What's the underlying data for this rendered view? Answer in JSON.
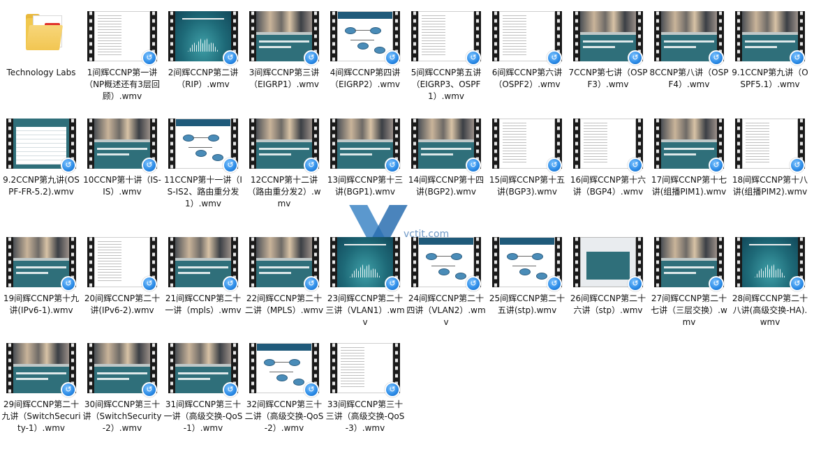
{
  "folder": {
    "label": "Technology Labs",
    "icon": "folder-icon"
  },
  "watermark": "vctit.com",
  "files": [
    {
      "label": "1间辉CCNP第一讲（NP概述还有3层回顾）.wmv",
      "thumb": "text"
    },
    {
      "label": "2间辉CCNP第二讲（RIP）.wmv",
      "thumb": "cisco"
    },
    {
      "label": "3间辉CCNP第三讲（EIGRP1）.wmv",
      "thumb": "slide"
    },
    {
      "label": "4间辉CCNP第四讲（EIGRP2）.wmv",
      "thumb": "diagram"
    },
    {
      "label": "5间辉CCNP第五讲（EIGRP3、OSPF1）.wmv",
      "thumb": "text"
    },
    {
      "label": "6间辉CCNP第六讲（OSPF2）.wmv",
      "thumb": "text"
    },
    {
      "label": "7CCNP第七讲（OSPF3）.wmv",
      "thumb": "slide"
    },
    {
      "label": "8CCNP第八讲（OSPF4）.wmv",
      "thumb": "slide"
    },
    {
      "label": "9.1CCNP第九讲（OSPF5.1）.wmv",
      "thumb": "slide"
    },
    {
      "label": "9.2CCNP第九讲(OSPF-FR-5.2).wmv",
      "thumb": "table"
    },
    {
      "label": "10CCNP第十讲（IS-IS）.wmv",
      "thumb": "slide"
    },
    {
      "label": "11CCNP第十一讲（IS-IS2、路由重分发1）.wmv",
      "thumb": "diagram"
    },
    {
      "label": "12CCNP第十二讲（路由重分发2）.wmv",
      "thumb": "slide"
    },
    {
      "label": "13间辉CCNP第十三讲(BGP1).wmv",
      "thumb": "slide"
    },
    {
      "label": "14间辉CCNP第十四讲(BGP2).wmv",
      "thumb": "slide"
    },
    {
      "label": "15间辉CCNP第十五讲(BGP3).wmv",
      "thumb": "text"
    },
    {
      "label": "16间辉CCNP第十六讲（BGP4）.wmv",
      "thumb": "text"
    },
    {
      "label": "17间辉CCNP第十七讲(组播PIM1).wmv",
      "thumb": "slide"
    },
    {
      "label": "18间辉CCNP第十八讲(组播PIM2).wmv",
      "thumb": "text"
    },
    {
      "label": "19间辉CCNP第十九讲(IPv6-1).wmv",
      "thumb": "slide"
    },
    {
      "label": "20间辉CCNP第二十讲(IPv6-2).wmv",
      "thumb": "text"
    },
    {
      "label": "21间辉CCNP第二十一讲（mpls）.wmv",
      "thumb": "slide"
    },
    {
      "label": "22间辉CCNP第二十二讲（MPLS）.wmv",
      "thumb": "slide"
    },
    {
      "label": "23间辉CCNP第二十三讲（VLAN1）.wmv",
      "thumb": "cisco"
    },
    {
      "label": "24间辉CCNP第二十四讲（VLAN2）.wmv",
      "thumb": "diagram"
    },
    {
      "label": "25间辉CCNP第二十五讲(stp).wmv",
      "thumb": "diagram"
    },
    {
      "label": "26间辉CCNP第二十六讲（stp）.wmv",
      "thumb": "shot"
    },
    {
      "label": "27间辉CCNP第二十七讲（三层交换）.wmv",
      "thumb": "slide"
    },
    {
      "label": "28间辉CCNP第二十八讲(高级交换-HA).wmv",
      "thumb": "cisco"
    },
    {
      "label": "29间辉CCNP第二十九讲（SwitchSecurity-1）.wmv",
      "thumb": "slide"
    },
    {
      "label": "30间辉CCNP第三十讲（SwitchSecurity-2）.wmv",
      "thumb": "slide"
    },
    {
      "label": "31间辉CCNP第三十一讲（高级交换-QoS-1）.wmv",
      "thumb": "slide"
    },
    {
      "label": "32间辉CCNP第三十二讲（高级交换-QoS-2）.wmv",
      "thumb": "diagram"
    },
    {
      "label": "33间辉CCNP第三十三讲（高级交换-QoS-3）.wmv",
      "thumb": "text"
    }
  ]
}
